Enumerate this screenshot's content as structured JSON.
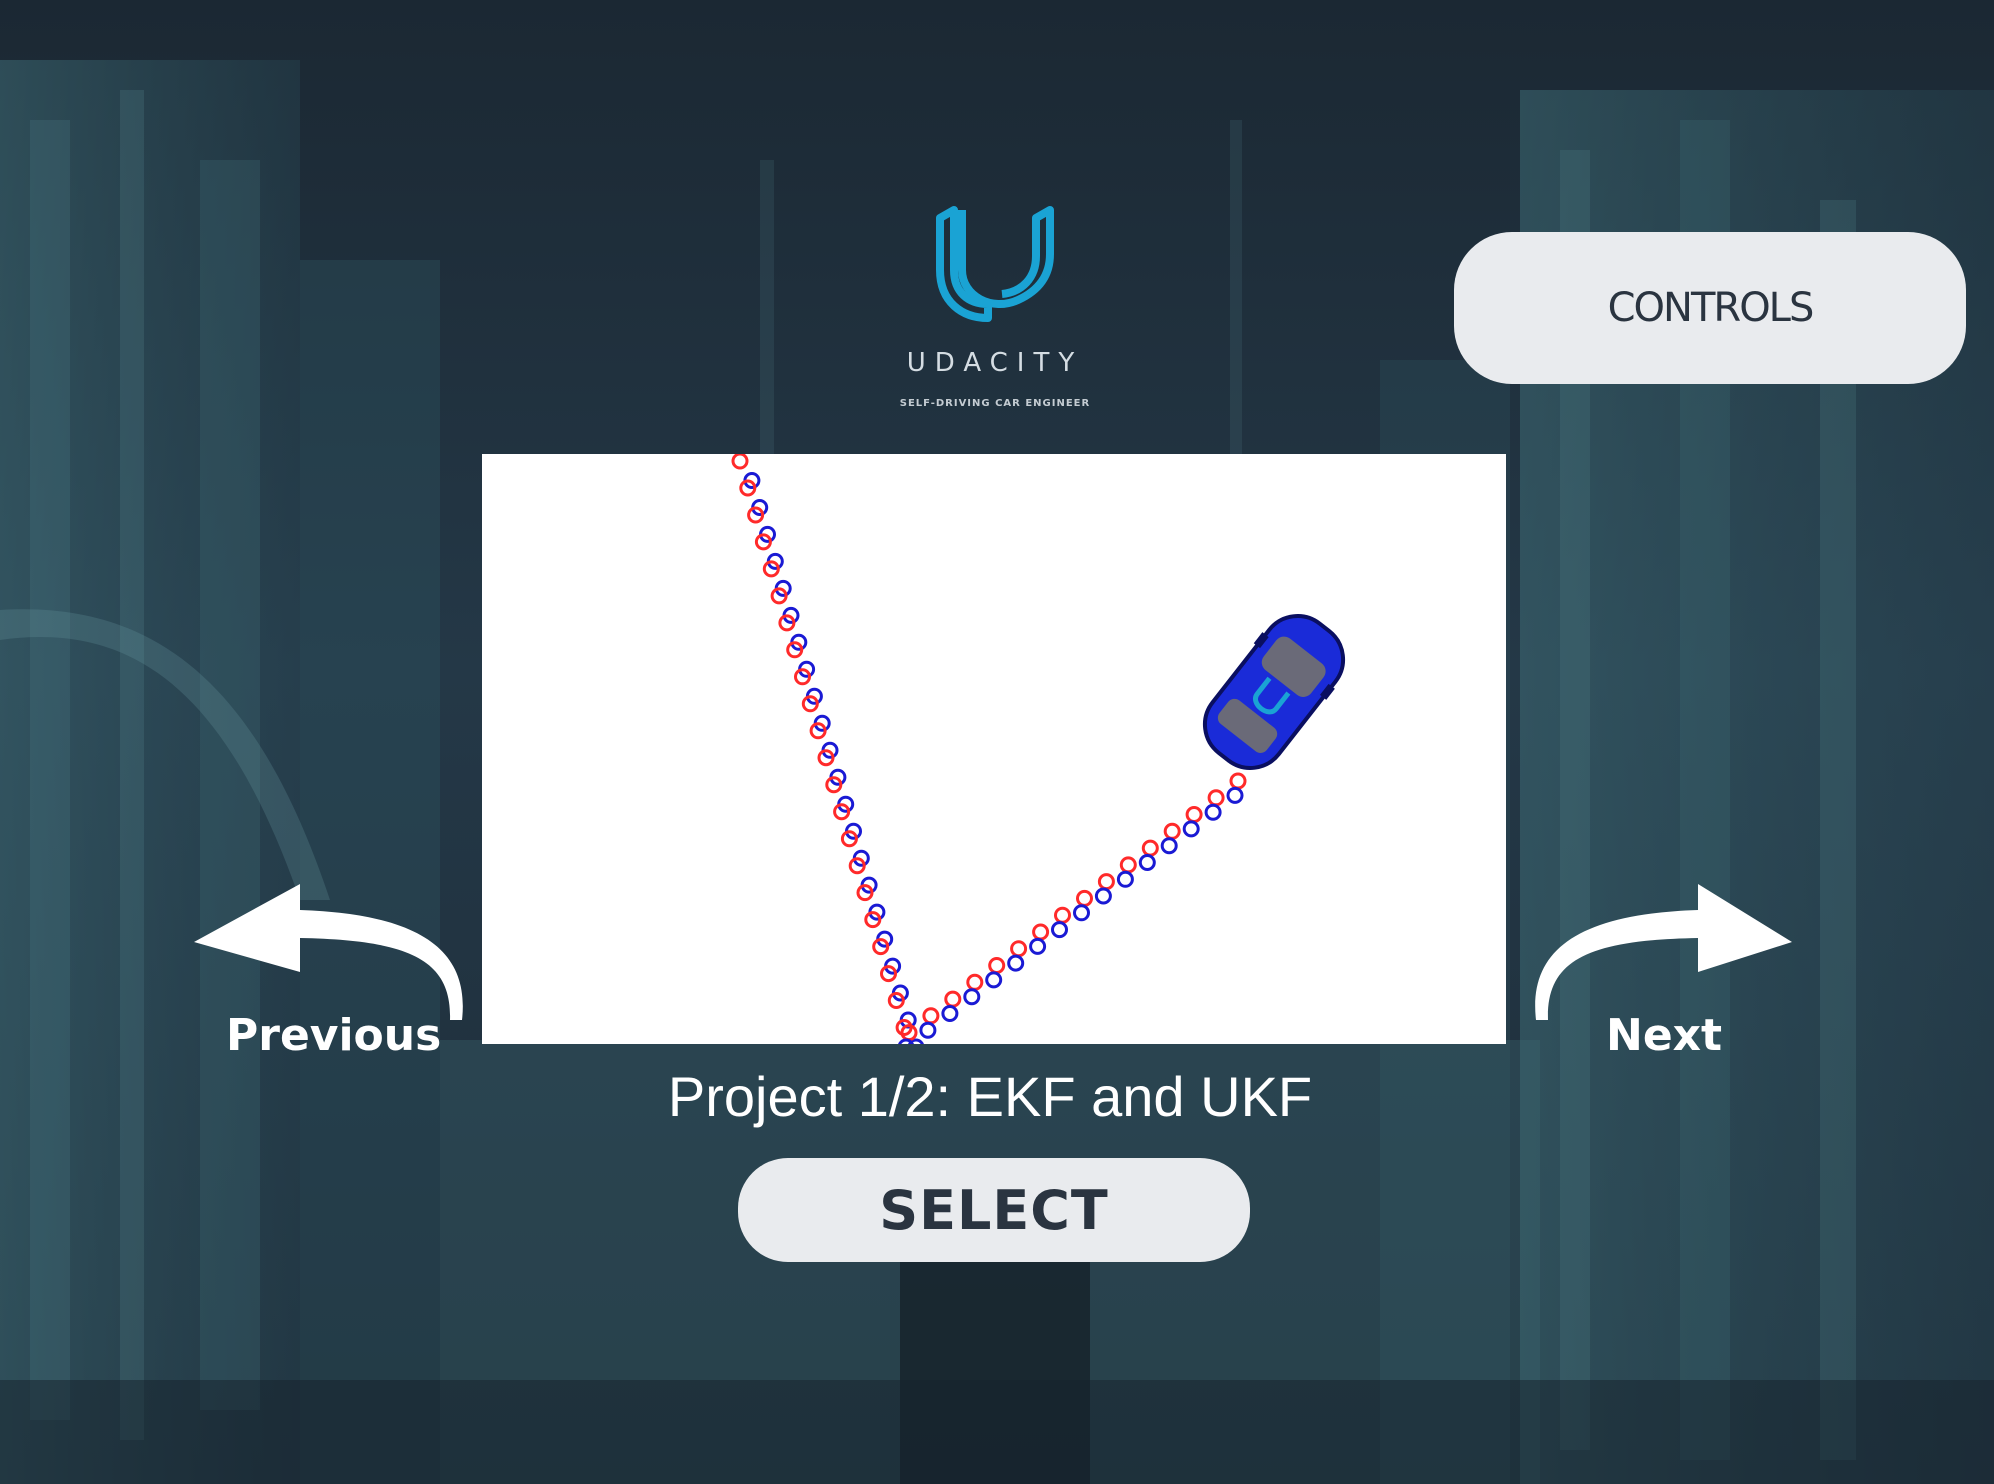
{
  "logo": {
    "wordmark": "UDACITY",
    "tagline": "SELF-DRIVING CAR ENGINEER",
    "accent": "#1aa3d4"
  },
  "controls_button": {
    "label": "CONTROLS"
  },
  "navigation": {
    "previous_label": "Previous",
    "next_label": "Next",
    "arrow_icons": [
      "curved-left-arrow-icon",
      "curved-right-arrow-icon"
    ]
  },
  "project": {
    "title": "Project 1/2: EKF and UKF",
    "select_label": "SELECT"
  },
  "preview": {
    "marker_colors": {
      "measurement": "#ff2a2a",
      "estimate": "#1a1ad4"
    },
    "car_color": "#1a2bd8"
  },
  "colors": {
    "background": "#1c2a36",
    "button_bg": "#e9ebee",
    "button_text": "#2a3440"
  }
}
